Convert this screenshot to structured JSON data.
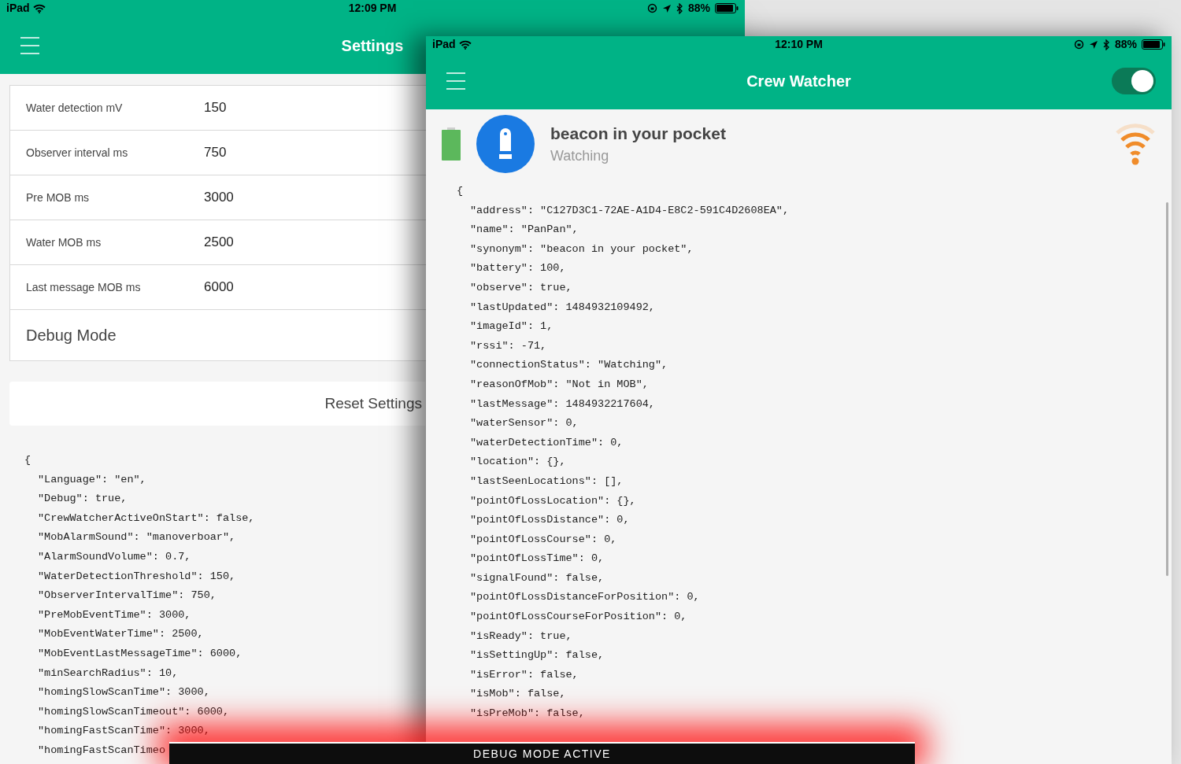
{
  "settings_window": {
    "status_bar": {
      "carrier": "iPad",
      "time": "12:09 PM",
      "battery": "88%"
    },
    "title": "Settings",
    "settings": [
      {
        "label": "Water detection mV",
        "value": "150"
      },
      {
        "label": "Observer interval ms",
        "value": "750"
      },
      {
        "label": "Pre MOB ms",
        "value": "3000"
      },
      {
        "label": "Water MOB ms",
        "value": "2500"
      },
      {
        "label": "Last message MOB ms",
        "value": "6000"
      }
    ],
    "debug_row": "Debug Mode",
    "reset_button": "Reset Settings",
    "json_open": "{",
    "json_lines": [
      "\"Language\": \"en\",",
      "\"Debug\": true,",
      "\"CrewWatcherActiveOnStart\": false,",
      "\"MobAlarmSound\": \"manoverboar\",",
      "\"AlarmSoundVolume\": 0.7,",
      "\"WaterDetectionThreshold\": 150,",
      "\"ObserverIntervalTime\": 750,",
      "\"PreMobEventTime\": 3000,",
      "\"MobEventWaterTime\": 2500,",
      "\"MobEventLastMessageTime\": 6000,",
      "\"minSearchRadius\": 10,",
      "\"homingSlowScanTime\": 3000,",
      "\"homingSlowScanTimeout\": 6000,",
      "\"homingFastScanTime\": 3000,",
      "\"homingFastScanTimeo"
    ]
  },
  "watcher_window": {
    "status_bar": {
      "carrier": "iPad",
      "time": "12:10 PM",
      "battery": "88%"
    },
    "title": "Crew Watcher",
    "toggle": {
      "on": true
    },
    "beacon": {
      "name": "beacon in your pocket",
      "status": "Watching"
    },
    "json_open": "{",
    "json_lines": [
      "\"address\": \"C127D3C1-72AE-A1D4-E8C2-591C4D2608EA\",",
      "\"name\": \"PanPan\",",
      "\"synonym\": \"beacon in your pocket\",",
      "\"battery\": 100,",
      "\"observe\": true,",
      "\"lastUpdated\": 1484932109492,",
      "\"imageId\": 1,",
      "\"rssi\": -71,",
      "\"connectionStatus\": \"Watching\",",
      "\"reasonOfMob\": \"Not in MOB\",",
      "\"lastMessage\": 1484932217604,",
      "\"waterSensor\": 0,",
      "\"waterDetectionTime\": 0,",
      "\"location\": {},",
      "\"lastSeenLocations\": [],",
      "\"pointOfLossLocation\": {},",
      "\"pointOfLossDistance\": 0,",
      "\"pointOfLossCourse\": 0,",
      "\"pointOfLossTime\": 0,",
      "\"signalFound\": false,",
      "\"pointOfLossDistanceForPosition\": 0,",
      "\"pointOfLossCourseForPosition\": 0,",
      "\"isReady\": true,",
      "\"isSettingUp\": false,",
      "\"isError\": false,",
      "\"isMob\": false,",
      "\"isPreMob\": false,"
    ]
  },
  "debug_banner": "DEBUG MODE ACTIVE"
}
